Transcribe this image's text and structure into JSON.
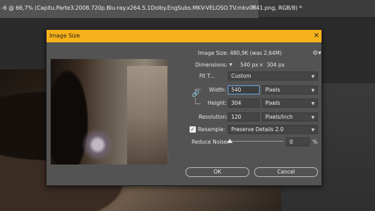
{
  "tab": {
    "title": "-6 @ 66,7% (Capitu.Parte3.2008.720p.Blu-ray.x264.5.1Dolby.EngSubs.MKV-VELOSO.TV.mkv0041.png, RGB/8) *",
    "close_glyph": "×"
  },
  "dialog": {
    "title": "Image Size",
    "close_glyph": "×",
    "image_size_label": "Image Size:",
    "image_size_value": "480,9K (was 2,64M)",
    "gear_icon": "gear-icon",
    "dimensions_label": "Dimensions:",
    "dimensions_width": "540 px",
    "dimensions_times": "×",
    "dimensions_height": "304 px",
    "fit_to_label": "Fit T...",
    "fit_to_value": "Custom",
    "width_label": "Width:",
    "width_value": "540",
    "width_unit": "Pixels",
    "height_label": "Height:",
    "height_value": "304",
    "height_unit": "Pixels",
    "resolution_label": "Resolution:",
    "resolution_value": "120",
    "resolution_unit": "Pixels/Inch",
    "resample_checked": true,
    "resample_label": "Resample:",
    "resample_value": "Preserve Details 2.0",
    "reduce_noise_label": "Reduce Noise:",
    "reduce_noise_value": "0",
    "reduce_noise_unit": "%",
    "ok_label": "OK",
    "cancel_label": "Cancel"
  },
  "colors": {
    "titlebar": "#f6b21b",
    "dialog_bg": "#535353",
    "focus_border": "#6aa6e8"
  }
}
